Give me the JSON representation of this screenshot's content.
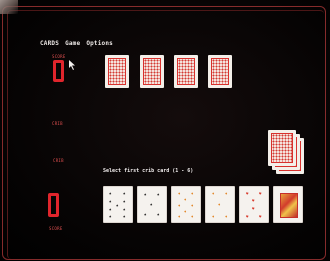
{
  "menu": {
    "items": [
      {
        "label": "CARDS"
      },
      {
        "label": "Game"
      },
      {
        "label": "Options"
      }
    ]
  },
  "scores": {
    "top_label": "SCORE",
    "top_peg_label": "CRIB",
    "bottom_peg_label": "CRIB",
    "bottom_label": "SCORE"
  },
  "prompt": {
    "text": "Select first crib card (1 - 6)"
  },
  "opponent_hand": {
    "count": 4
  },
  "player_hand": [
    {
      "suit": "spades",
      "color": "black"
    },
    {
      "suit": "spades",
      "color": "black"
    },
    {
      "suit": "diamonds",
      "color": "orange"
    },
    {
      "suit": "diamonds",
      "color": "orange"
    },
    {
      "suit": "hearts",
      "color": "red"
    },
    {
      "suit": "face",
      "color": "red"
    }
  ],
  "deck": {
    "remaining": "stack"
  },
  "colors": {
    "background": "#0b0606",
    "accent_red": "#e0252c",
    "text": "#ede8e6"
  }
}
